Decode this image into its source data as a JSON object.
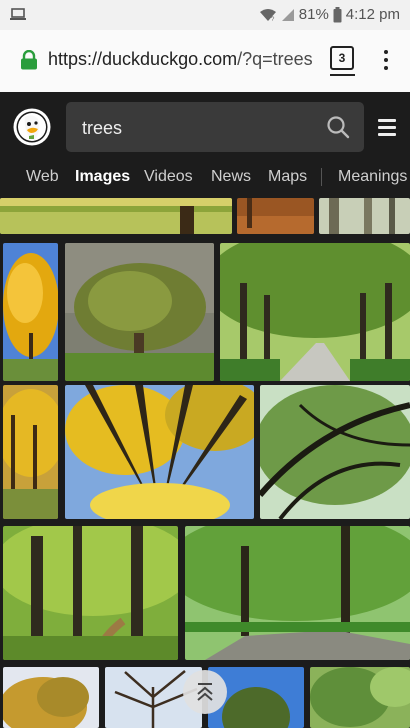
{
  "status_bar": {
    "battery": "81%",
    "time": "4:12 pm"
  },
  "browser": {
    "url_host": "https://duckduckgo.com",
    "url_path": "/?q=trees",
    "tab_count": "3"
  },
  "search": {
    "query": "trees"
  },
  "nav": {
    "tabs": [
      {
        "label": "Web",
        "active": false
      },
      {
        "label": "Images",
        "active": true
      },
      {
        "label": "Videos",
        "active": false
      },
      {
        "label": "News",
        "active": false
      },
      {
        "label": "Maps",
        "active": false
      },
      {
        "label": "Meanings",
        "active": false
      }
    ]
  },
  "icons": [
    "laptop-icon",
    "wifi-icon",
    "signal-icon",
    "battery-icon",
    "lock-icon",
    "tabs-icon",
    "kebab-menu-icon",
    "duck-logo-icon",
    "search-icon",
    "hamburger-menu-icon",
    "scroll-to-top-icon"
  ],
  "colors": {
    "header_bg": "#1c1c1c",
    "search_bg": "#3a3a3a",
    "lock_green": "#2a9d3c"
  },
  "results": [
    {
      "description": "row 0 image 1"
    }
  ]
}
